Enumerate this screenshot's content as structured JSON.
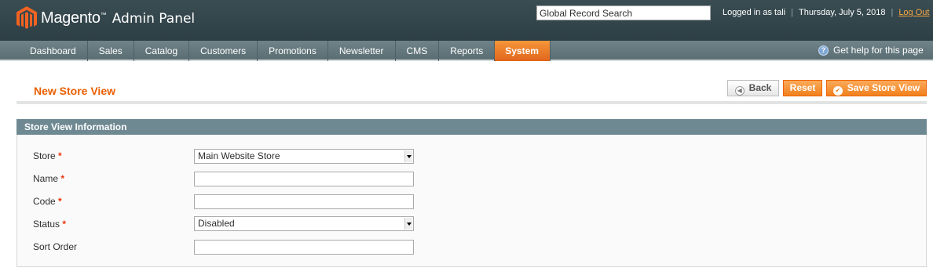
{
  "header": {
    "brand": "Magento",
    "brand_suffix": "Admin Panel",
    "search_value": "Global Record Search",
    "logged_in": "Logged in as tali",
    "date": "Thursday, July 5, 2018",
    "logout": "Log Out"
  },
  "nav": {
    "items": [
      "Dashboard",
      "Sales",
      "Catalog",
      "Customers",
      "Promotions",
      "Newsletter",
      "CMS",
      "Reports",
      "System"
    ],
    "active": "System",
    "help": "Get help for this page"
  },
  "page": {
    "title": "New Store View",
    "back_label": "Back",
    "reset_label": "Reset",
    "save_label": "Save Store View"
  },
  "form": {
    "section_title": "Store View Information",
    "store_label": "Store",
    "store_value": "Main Website Store",
    "name_label": "Name",
    "name_value": "",
    "code_label": "Code",
    "code_value": "",
    "status_label": "Status",
    "status_value": "Disabled",
    "sort_label": "Sort Order",
    "sort_value": "",
    "required_mark": "*"
  },
  "colors": {
    "accent": "#eb5e00",
    "header_bg": "#2d3f45",
    "nav_bg": "#5a6d73",
    "section_head_bg": "#6f8992"
  }
}
